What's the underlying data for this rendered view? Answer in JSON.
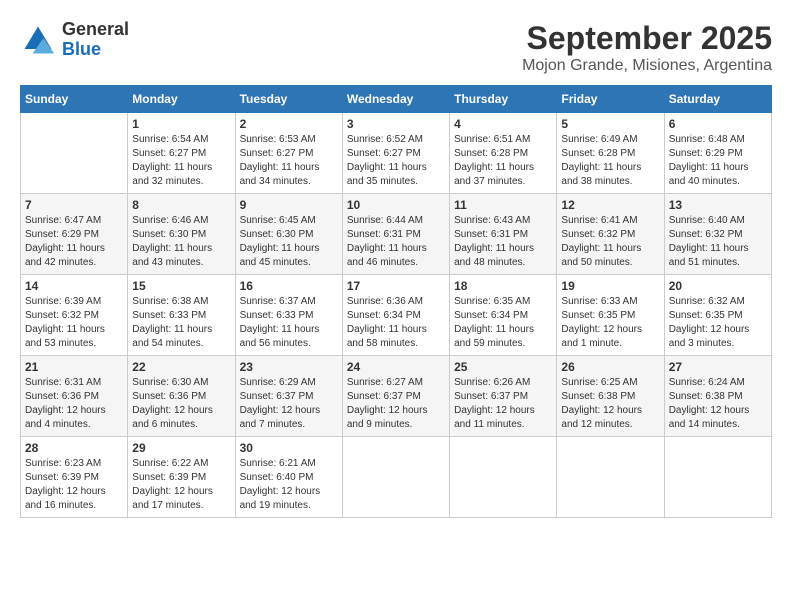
{
  "header": {
    "logo_general": "General",
    "logo_blue": "Blue",
    "title": "September 2025",
    "subtitle": "Mojon Grande, Misiones, Argentina"
  },
  "days_of_week": [
    "Sunday",
    "Monday",
    "Tuesday",
    "Wednesday",
    "Thursday",
    "Friday",
    "Saturday"
  ],
  "weeks": [
    [
      {
        "day": "",
        "info": ""
      },
      {
        "day": "1",
        "info": "Sunrise: 6:54 AM\nSunset: 6:27 PM\nDaylight: 11 hours\nand 32 minutes."
      },
      {
        "day": "2",
        "info": "Sunrise: 6:53 AM\nSunset: 6:27 PM\nDaylight: 11 hours\nand 34 minutes."
      },
      {
        "day": "3",
        "info": "Sunrise: 6:52 AM\nSunset: 6:27 PM\nDaylight: 11 hours\nand 35 minutes."
      },
      {
        "day": "4",
        "info": "Sunrise: 6:51 AM\nSunset: 6:28 PM\nDaylight: 11 hours\nand 37 minutes."
      },
      {
        "day": "5",
        "info": "Sunrise: 6:49 AM\nSunset: 6:28 PM\nDaylight: 11 hours\nand 38 minutes."
      },
      {
        "day": "6",
        "info": "Sunrise: 6:48 AM\nSunset: 6:29 PM\nDaylight: 11 hours\nand 40 minutes."
      }
    ],
    [
      {
        "day": "7",
        "info": "Sunrise: 6:47 AM\nSunset: 6:29 PM\nDaylight: 11 hours\nand 42 minutes."
      },
      {
        "day": "8",
        "info": "Sunrise: 6:46 AM\nSunset: 6:30 PM\nDaylight: 11 hours\nand 43 minutes."
      },
      {
        "day": "9",
        "info": "Sunrise: 6:45 AM\nSunset: 6:30 PM\nDaylight: 11 hours\nand 45 minutes."
      },
      {
        "day": "10",
        "info": "Sunrise: 6:44 AM\nSunset: 6:31 PM\nDaylight: 11 hours\nand 46 minutes."
      },
      {
        "day": "11",
        "info": "Sunrise: 6:43 AM\nSunset: 6:31 PM\nDaylight: 11 hours\nand 48 minutes."
      },
      {
        "day": "12",
        "info": "Sunrise: 6:41 AM\nSunset: 6:32 PM\nDaylight: 11 hours\nand 50 minutes."
      },
      {
        "day": "13",
        "info": "Sunrise: 6:40 AM\nSunset: 6:32 PM\nDaylight: 11 hours\nand 51 minutes."
      }
    ],
    [
      {
        "day": "14",
        "info": "Sunrise: 6:39 AM\nSunset: 6:32 PM\nDaylight: 11 hours\nand 53 minutes."
      },
      {
        "day": "15",
        "info": "Sunrise: 6:38 AM\nSunset: 6:33 PM\nDaylight: 11 hours\nand 54 minutes."
      },
      {
        "day": "16",
        "info": "Sunrise: 6:37 AM\nSunset: 6:33 PM\nDaylight: 11 hours\nand 56 minutes."
      },
      {
        "day": "17",
        "info": "Sunrise: 6:36 AM\nSunset: 6:34 PM\nDaylight: 11 hours\nand 58 minutes."
      },
      {
        "day": "18",
        "info": "Sunrise: 6:35 AM\nSunset: 6:34 PM\nDaylight: 11 hours\nand 59 minutes."
      },
      {
        "day": "19",
        "info": "Sunrise: 6:33 AM\nSunset: 6:35 PM\nDaylight: 12 hours\nand 1 minute."
      },
      {
        "day": "20",
        "info": "Sunrise: 6:32 AM\nSunset: 6:35 PM\nDaylight: 12 hours\nand 3 minutes."
      }
    ],
    [
      {
        "day": "21",
        "info": "Sunrise: 6:31 AM\nSunset: 6:36 PM\nDaylight: 12 hours\nand 4 minutes."
      },
      {
        "day": "22",
        "info": "Sunrise: 6:30 AM\nSunset: 6:36 PM\nDaylight: 12 hours\nand 6 minutes."
      },
      {
        "day": "23",
        "info": "Sunrise: 6:29 AM\nSunset: 6:37 PM\nDaylight: 12 hours\nand 7 minutes."
      },
      {
        "day": "24",
        "info": "Sunrise: 6:27 AM\nSunset: 6:37 PM\nDaylight: 12 hours\nand 9 minutes."
      },
      {
        "day": "25",
        "info": "Sunrise: 6:26 AM\nSunset: 6:37 PM\nDaylight: 12 hours\nand 11 minutes."
      },
      {
        "day": "26",
        "info": "Sunrise: 6:25 AM\nSunset: 6:38 PM\nDaylight: 12 hours\nand 12 minutes."
      },
      {
        "day": "27",
        "info": "Sunrise: 6:24 AM\nSunset: 6:38 PM\nDaylight: 12 hours\nand 14 minutes."
      }
    ],
    [
      {
        "day": "28",
        "info": "Sunrise: 6:23 AM\nSunset: 6:39 PM\nDaylight: 12 hours\nand 16 minutes."
      },
      {
        "day": "29",
        "info": "Sunrise: 6:22 AM\nSunset: 6:39 PM\nDaylight: 12 hours\nand 17 minutes."
      },
      {
        "day": "30",
        "info": "Sunrise: 6:21 AM\nSunset: 6:40 PM\nDaylight: 12 hours\nand 19 minutes."
      },
      {
        "day": "",
        "info": ""
      },
      {
        "day": "",
        "info": ""
      },
      {
        "day": "",
        "info": ""
      },
      {
        "day": "",
        "info": ""
      }
    ]
  ]
}
